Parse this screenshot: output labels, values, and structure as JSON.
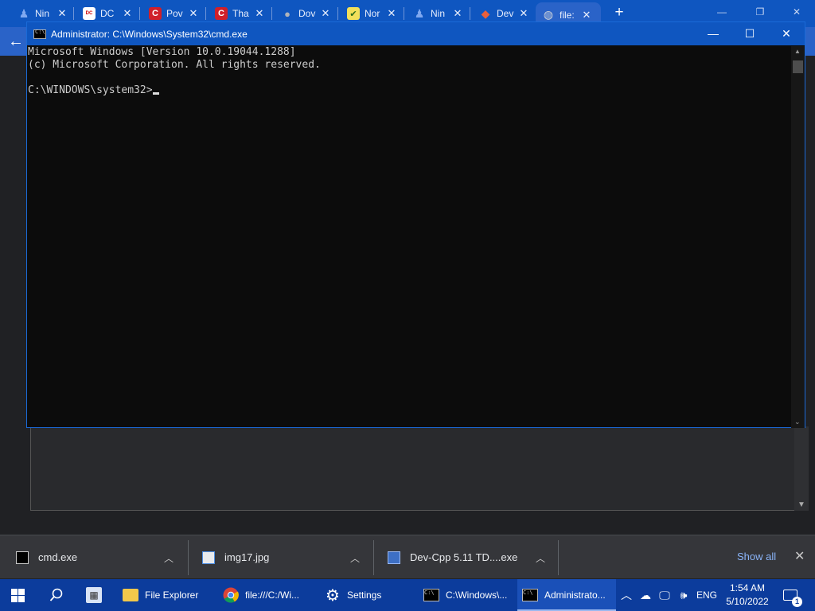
{
  "browser": {
    "tabs": [
      {
        "title": "Nin",
        "icon": "person-icon",
        "color": "#4f86e8"
      },
      {
        "title": "DC",
        "icon": "dc-logo-icon",
        "color": "#ffffff"
      },
      {
        "title": "Pov",
        "icon": "c-logo-icon",
        "color": "#d0202a"
      },
      {
        "title": "Tha",
        "icon": "c-logo-icon",
        "color": "#d0202a"
      },
      {
        "title": "Dov",
        "icon": "apple-icon",
        "color": "#9aa0a6"
      },
      {
        "title": "Nor",
        "icon": "checkmark-icon",
        "color": "#f2e05a"
      },
      {
        "title": "Nin",
        "icon": "person-icon",
        "color": "#4f86e8"
      },
      {
        "title": "Dev",
        "icon": "diamond-icon",
        "color": "#e8603c"
      },
      {
        "title": "file:",
        "icon": "globe-icon",
        "color": "#9aa0a6"
      }
    ],
    "new_tab_glyph": "+",
    "back_glyph": "←"
  },
  "cmd": {
    "title": "Administrator: C:\\Windows\\System32\\cmd.exe",
    "lines": [
      "Microsoft Windows [Version 10.0.19044.1288]",
      "(c) Microsoft Corporation. All rights reserved.",
      "",
      "C:\\WINDOWS\\system32>"
    ]
  },
  "downloads": {
    "items": [
      {
        "name": "cmd.exe",
        "icon": "cmd-file-icon"
      },
      {
        "name": "img17.jpg",
        "icon": "image-file-icon"
      },
      {
        "name": "Dev-Cpp 5.11 TD....exe",
        "icon": "installer-file-icon"
      }
    ],
    "show_all": "Show all"
  },
  "taskbar": {
    "items": [
      {
        "label": "File Explorer",
        "icon": "folder-icon"
      },
      {
        "label": "file:///C:/Wi...",
        "icon": "chrome-icon"
      },
      {
        "label": "Settings",
        "icon": "gear-icon"
      },
      {
        "label": "C:\\Windows\\...",
        "icon": "cmd-icon"
      },
      {
        "label": "Administrato...",
        "icon": "cmd-icon"
      }
    ],
    "language": "ENG",
    "time": "1:54 AM",
    "date": "5/10/2022",
    "notification_count": "1"
  }
}
